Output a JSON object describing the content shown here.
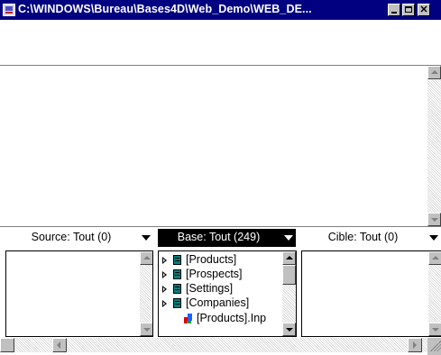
{
  "window": {
    "title": "C:\\WINDOWS\\Bureau\\Bases4D\\Web_Demo\\WEB_DE...",
    "buttons": {
      "minimize": "_",
      "maximize": "□",
      "close": "✕"
    }
  },
  "panels": {
    "source": {
      "header": "Source: Tout (0)"
    },
    "base": {
      "header": "Base: Tout (249)",
      "items": [
        {
          "label": "[Products]",
          "icon": "table-icon",
          "expandable": true
        },
        {
          "label": "[Prospects]",
          "icon": "table-icon",
          "expandable": true
        },
        {
          "label": "[Settings]",
          "icon": "table-icon",
          "expandable": true
        },
        {
          "label": "[Companies]",
          "icon": "table-icon",
          "expandable": true
        },
        {
          "label": "[Products].Inp",
          "icon": "field-icon",
          "expandable": false
        }
      ]
    },
    "target": {
      "header": "Cible: Tout (0)"
    }
  },
  "colors": {
    "titlebar": "#000080",
    "active_header": "#000000",
    "table_icon": "#008080",
    "chrome": "#c0c0c0"
  }
}
